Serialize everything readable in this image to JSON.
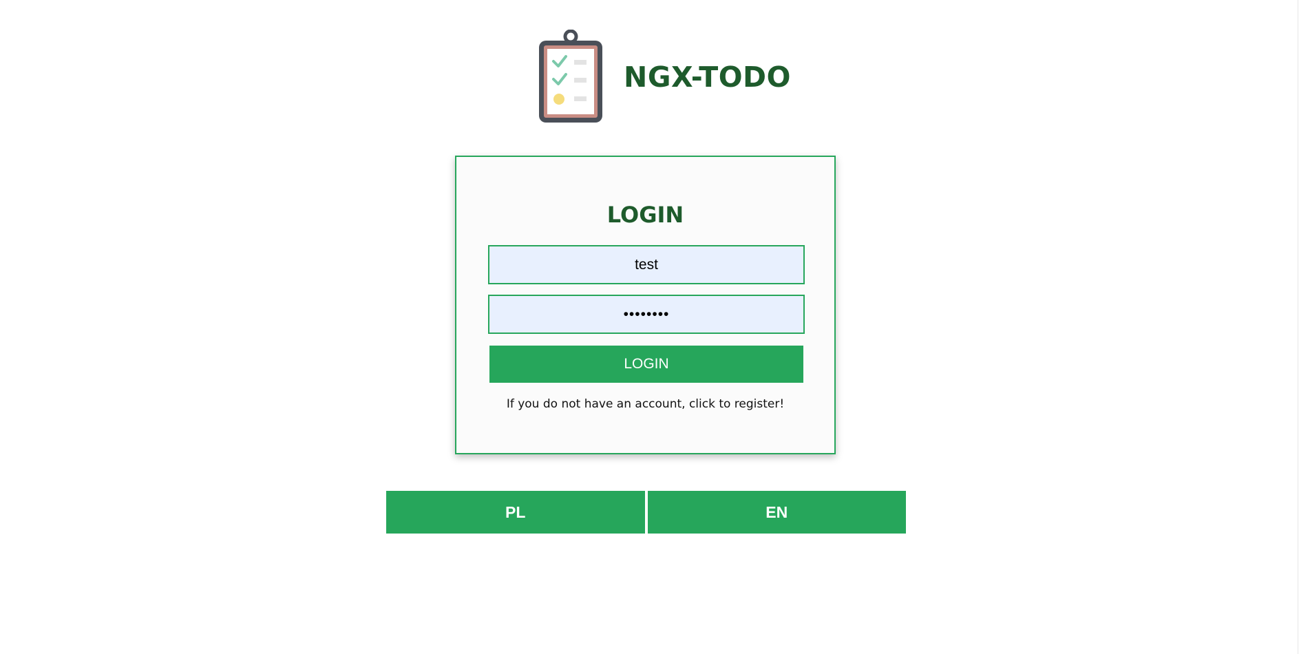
{
  "header": {
    "logo_icon": "clipboard-checklist-icon",
    "title": "NGX-TODO"
  },
  "login_form": {
    "heading": "LOGIN",
    "username_value": "test",
    "password_value": "********",
    "submit_label": "LOGIN",
    "register_text": "If you do not have an account, click to register!"
  },
  "language_switcher": {
    "options": [
      "PL",
      "EN"
    ]
  },
  "colors": {
    "accent": "#26a65b",
    "title": "#1e5b2c",
    "input_background": "#e8f0fe",
    "card_background": "#fbfbfb"
  }
}
